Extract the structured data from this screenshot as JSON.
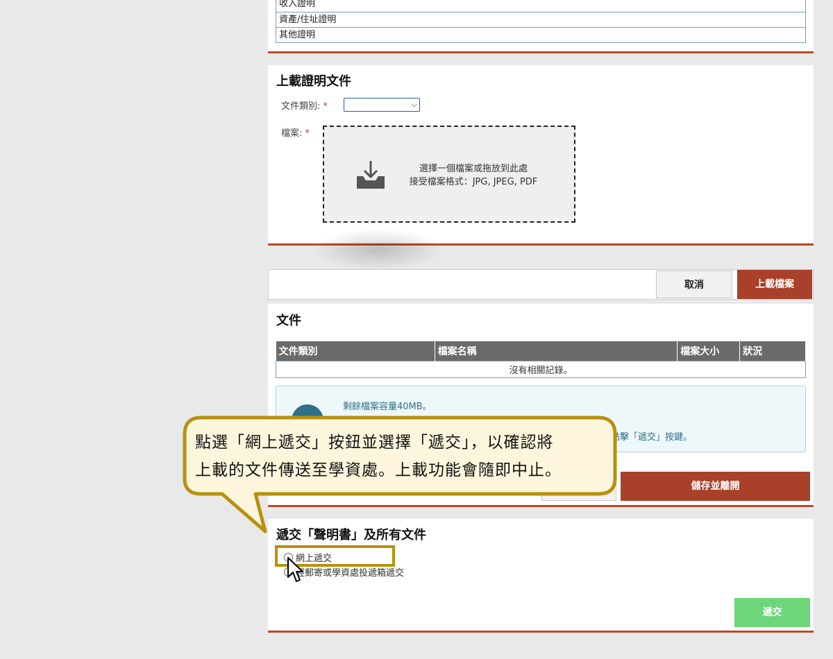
{
  "top_list": {
    "items": [
      "收入證明",
      "資產/住址證明",
      "其他證明"
    ]
  },
  "upload_section": {
    "title": "上載證明文件",
    "doc_type_label": "文件類別:",
    "file_label": "檔案:",
    "required_mark": "*",
    "doc_type_value": "",
    "dropzone_line1": "選擇一個檔案或拖放到此處",
    "dropzone_line2": "接受檔案格式：JPG, JPEG, PDF"
  },
  "action_bar": {
    "cancel_label": "取消",
    "upload_label": "上載檔案"
  },
  "documents_section": {
    "title": "文件",
    "columns": [
      "文件類別",
      "檔案名稱",
      "檔案大小",
      "狀況"
    ],
    "empty_message": "沒有相關記錄。"
  },
  "info_box": {
    "line1": "剩餘檔案容量40MB。",
    "line2": "點擊「遞交」按鍵。"
  },
  "save_bar": {
    "save_exit_label": "儲存並離開"
  },
  "submit_section": {
    "title": "遞交「聲明書」及所有文件",
    "option_online": "網上遞交",
    "option_post": "經郵寄或學資處投遞箱遞交",
    "submit_label": "遞交"
  },
  "callout": {
    "line1": "點選「網上遞交」按鈕並選擇「遞交」，以確認將",
    "line2": "上載的文件傳送至學資處。上載功能會隨即中止。"
  },
  "colors": {
    "accent": "#b94a24",
    "primary_button": "#a8402a",
    "submit_button": "#6dd57a",
    "callout_fill": "#fdf6dd",
    "callout_border": "#b8900d"
  }
}
